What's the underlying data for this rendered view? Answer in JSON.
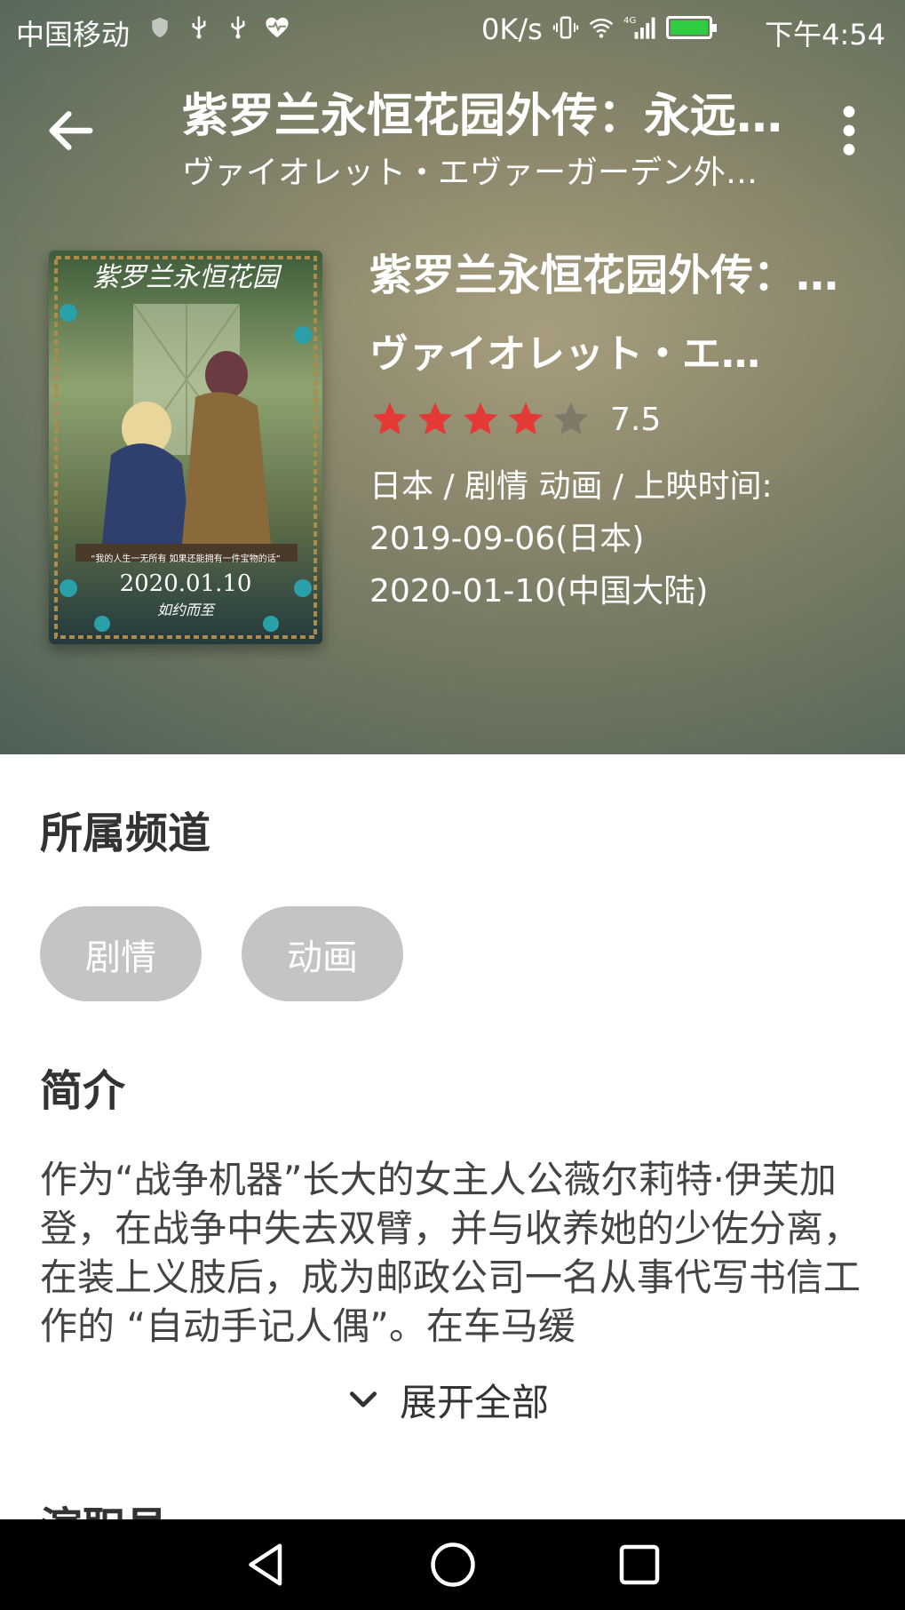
{
  "status_bar": {
    "carrier": "中国移动",
    "net_speed": "0K/s",
    "time": "下午4:54",
    "signal_label": "4G",
    "icons": [
      "shield-icon",
      "usb-icon",
      "usb-icon",
      "heart-monitor-icon",
      "vibrate-icon",
      "wifi-icon",
      "signal-icon",
      "battery-icon"
    ],
    "battery_color": "#2ecc40"
  },
  "toolbar": {
    "title": "紫罗兰永恒花园外传：永远与自动手记人偶",
    "subtitle": "ヴァイオレット・エヴァーガーデン外伝 - 永遠と自動手記人形 -"
  },
  "movie": {
    "title": "紫罗兰永恒花园外传：永远与自动手记人偶",
    "original_title": "ヴァイオレット・エヴァーガーデン外伝",
    "rating": 7.5,
    "rating_text": "7.5",
    "stars_filled": 4,
    "stars_total": 5,
    "meta_line1": "日本  / 剧情 动画 / 上映时间:",
    "meta_line2": "2019-09-06(日本)",
    "meta_line3": "2020-01-10(中国大陆)",
    "poster": {
      "title_text": "紫罗兰永恒花园",
      "tagline": "“我的人生一无所有  如果还能拥有一件宝物的话”",
      "date": "2020.01.10",
      "signature": "如约而至"
    }
  },
  "channels": {
    "heading": "所属频道",
    "tags": [
      "剧情",
      "动画"
    ]
  },
  "intro": {
    "heading": "简介",
    "text": "作为“战争机器”长大的女主人公薇尔莉特·伊芙加登，在战争中失去双臂，并与收养她的少佐分离，在装上义肢后，成为邮政公司一名从事代写书信工作的 “自动手记人偶”。在车马缓",
    "expand_label": "展开全部"
  },
  "cast": {
    "heading": "演职员"
  },
  "colors": {
    "star_filled": "#e53935",
    "star_empty": "#7d7a6a",
    "tag_bg": "#c4c4c4"
  }
}
